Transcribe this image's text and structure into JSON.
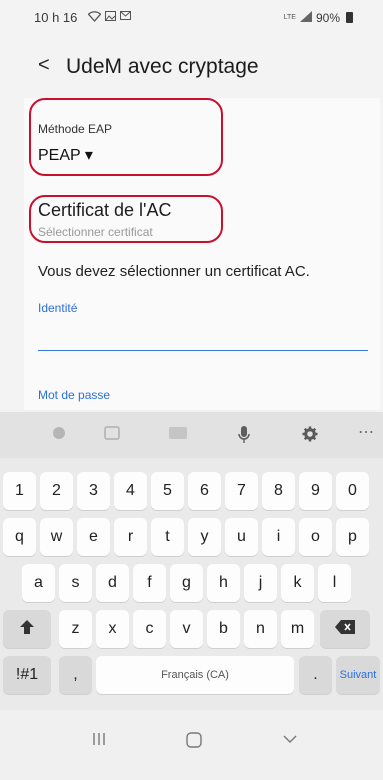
{
  "status_bar": {
    "time": "10 h 16",
    "network": "LTE",
    "battery": "90%"
  },
  "header": {
    "back_glyph": "<",
    "title": "UdeM avec cryptage"
  },
  "eap": {
    "label": "Méthode EAP",
    "value": "PEAP ▾"
  },
  "cert": {
    "title": "Certificat de l'AC",
    "subtitle": "Sélectionner certificat"
  },
  "notice": "Vous devez sélectionner un certificat AC.",
  "identity": {
    "label": "Identité"
  },
  "password": {
    "label": "Mot de passe"
  },
  "keyboard": {
    "numbers": [
      "1",
      "2",
      "3",
      "4",
      "5",
      "6",
      "7",
      "8",
      "9",
      "0"
    ],
    "row1": [
      "q",
      "w",
      "e",
      "r",
      "t",
      "y",
      "u",
      "i",
      "o",
      "p"
    ],
    "row2": [
      "a",
      "s",
      "d",
      "f",
      "g",
      "h",
      "j",
      "k",
      "l"
    ],
    "row3": [
      "z",
      "x",
      "c",
      "v",
      "b",
      "n",
      "m"
    ],
    "symbols_key": "!#1",
    "comma_key": ",",
    "space_key": "Français (CA)",
    "period_key": ".",
    "next_key": "Suivant"
  }
}
